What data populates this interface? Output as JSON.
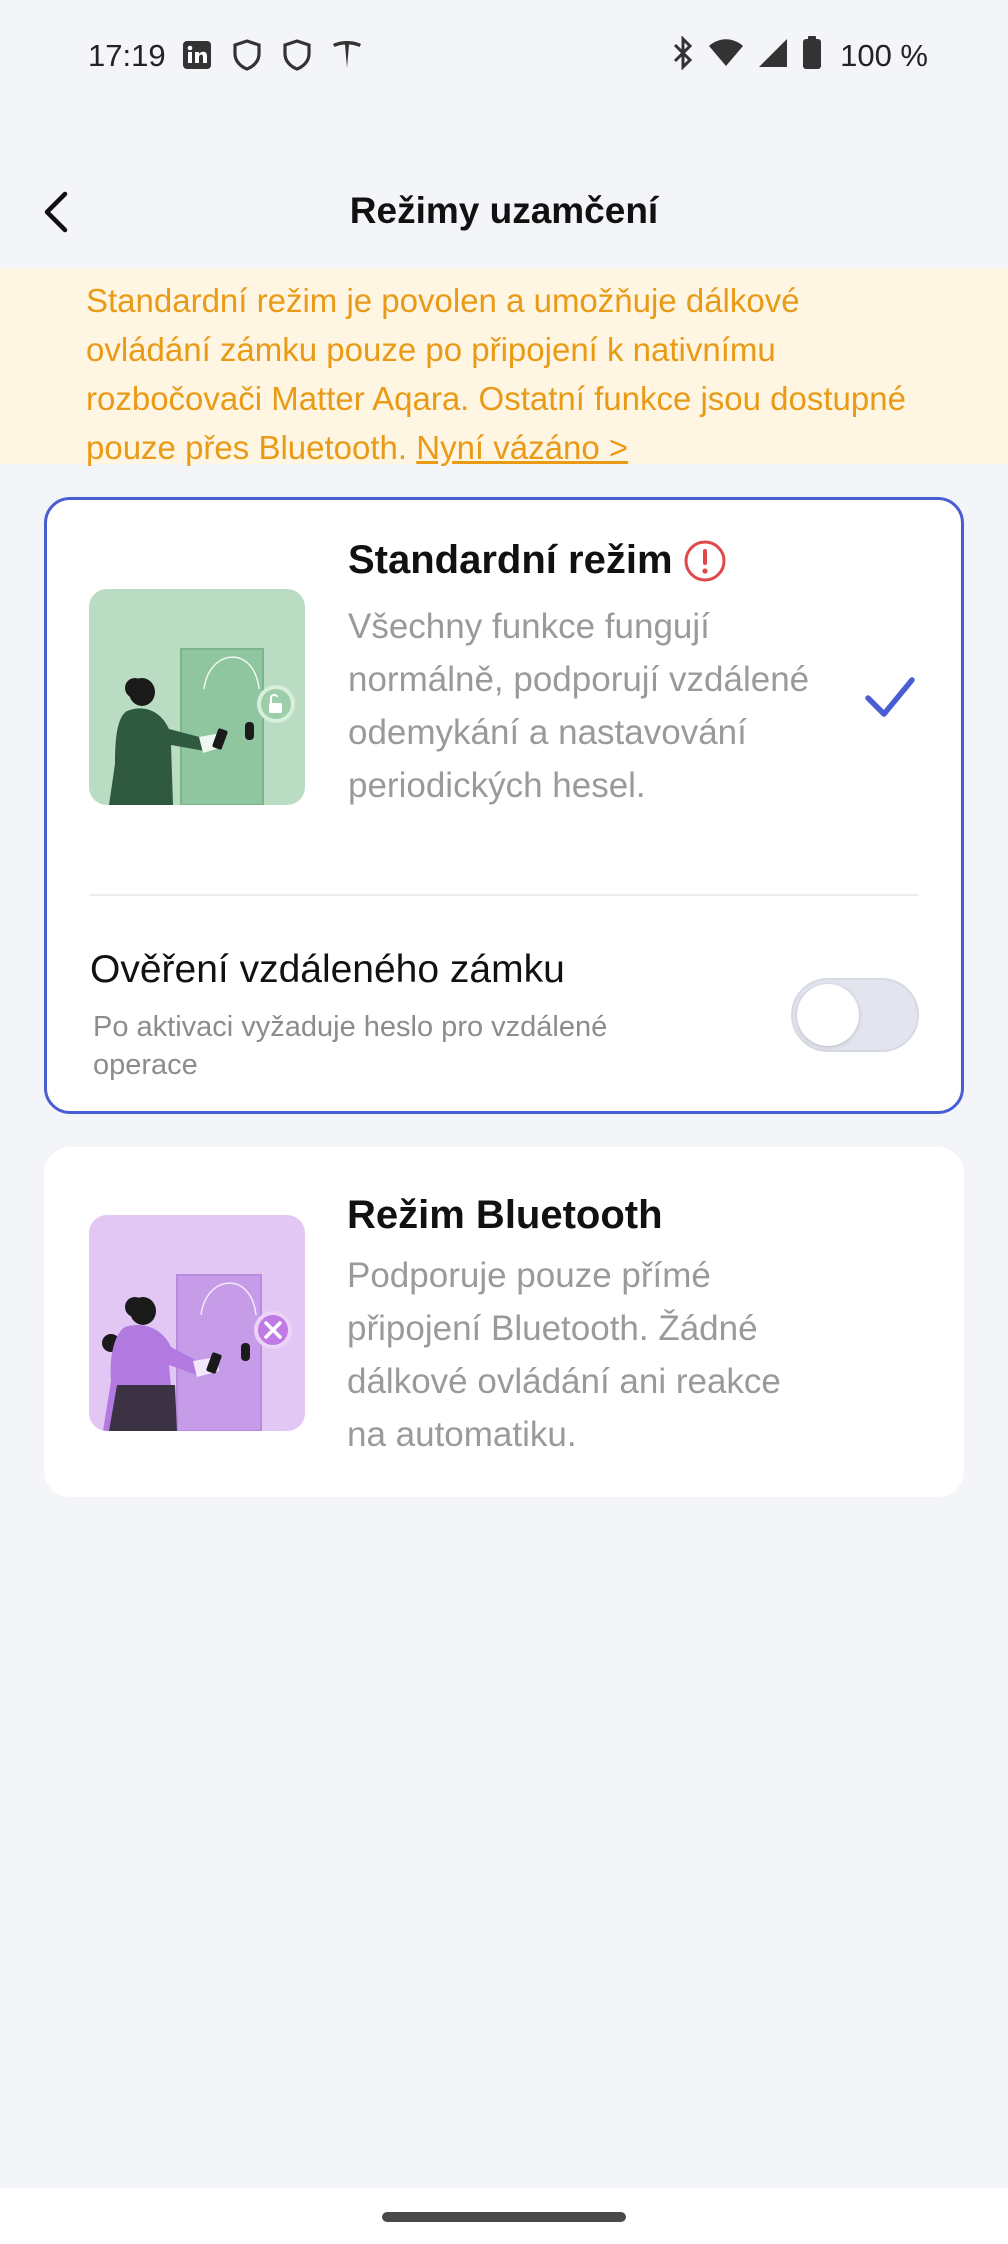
{
  "status_bar": {
    "time": "17:19",
    "left_icons": [
      "linkedin-icon",
      "shield-icon",
      "shield-icon",
      "tesla-icon"
    ],
    "right_icons": [
      "bluetooth-icon",
      "wifi-icon",
      "signal-icon",
      "battery-icon"
    ],
    "battery_text": "100 %"
  },
  "header": {
    "title": "Režimy uzamčení",
    "back_icon": "chevron-left-icon"
  },
  "banner": {
    "text": "Standardní režim je povolen a umožňuje dálkové ovládání zámku pouze po připojení k nativnímu rozbočovači Matter Aqara. Ostatní funkce jsou dostupné pouze přes Bluetooth.",
    "link": "Nyní vázáno >",
    "color": "#e99a16",
    "background": "#fef6e2"
  },
  "modes": {
    "standard": {
      "title": "Standardní režim",
      "description": "Všechny funkce fungují normálně, podporují vzdálené odemykání a nastavování periodických hesel.",
      "selected": true,
      "status_icon": "alert-circle-icon",
      "check_icon": "checkmark-icon",
      "remote_verification": {
        "title": "Ověření vzdáleného zámku",
        "subtitle": "Po aktivaci vyžaduje heslo pro vzdálené operace",
        "enabled": false
      }
    },
    "bluetooth": {
      "title": "Režim Bluetooth",
      "description": "Podporuje pouze přímé připojení Bluetooth. Žádné dálkové ovládání ani reakce na automatiku.",
      "selected": false,
      "badge_icon": "close-icon"
    }
  },
  "colors": {
    "accent": "#4a5ed4",
    "alert": "#e0484a",
    "standard_illustration_bg": "#b9dcc2",
    "bluetooth_illustration_bg": "#e2c7f4"
  }
}
